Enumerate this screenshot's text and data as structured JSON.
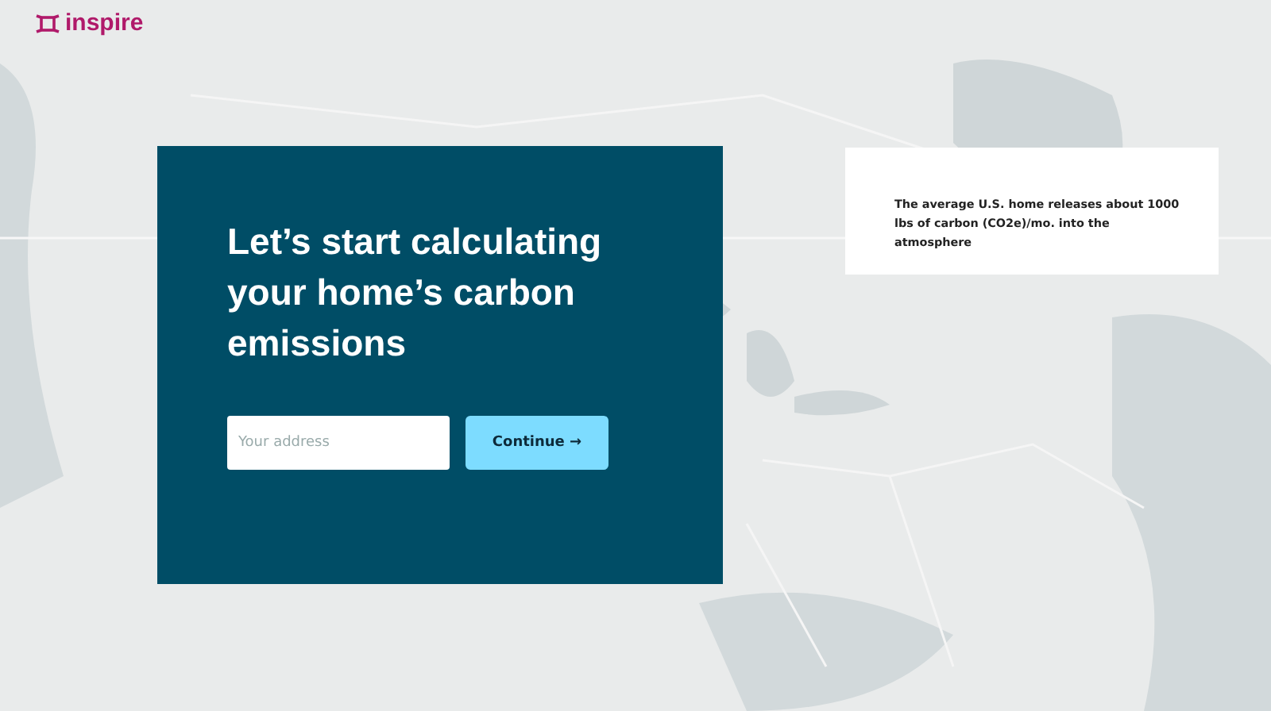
{
  "logo": {
    "text": "inspire"
  },
  "calculator_card": {
    "heading": "Let’s start calculating your home’s carbon emissions",
    "address_field": {
      "placeholder": "Your address"
    },
    "button": "Continue →"
  },
  "info_card": {
    "text": "The average U.S. home releases about 1000 lbs of carbon (CO2e)/mo. into the atmosphere"
  }
}
